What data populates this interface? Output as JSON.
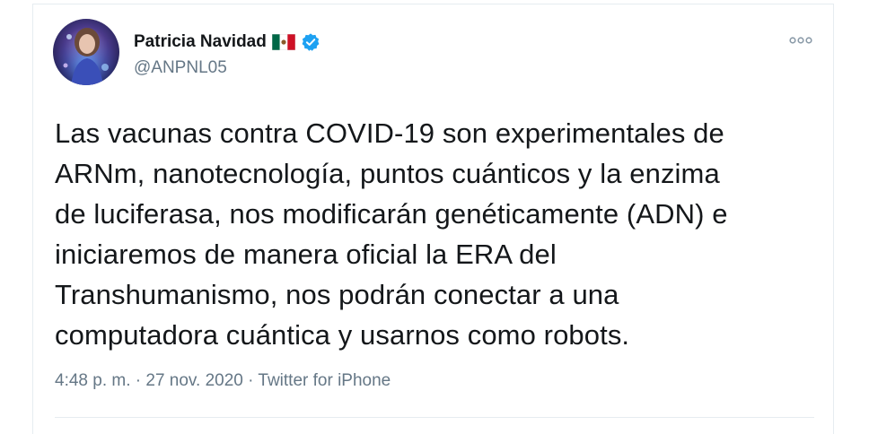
{
  "tweet": {
    "author": {
      "name": "Patricia Navidad",
      "handle": "@ANPNL05",
      "flag_icon": "mexico-flag-icon",
      "verified_icon": "verified-badge-icon"
    },
    "more_icon": "more-options-icon",
    "text_lines": [
      "Las vacunas contra COVID-19 son experimentales de",
      "ARNm, nanotecnología, puntos cuánticos y la enzima",
      "de luciferasa, nos modificarán genéticamente (ADN) e",
      "iniciaremos de manera oficial la ERA del",
      "Transhumanismo, nos podrán conectar a una",
      "computadora cuántica y usarnos como robots."
    ],
    "time": "4:48 p. m.",
    "separator": "·",
    "date": "27 nov. 2020",
    "source": "Twitter for iPhone"
  },
  "colors": {
    "text_primary": "#14171a",
    "text_secondary": "#657786",
    "verified_blue": "#1da1f2",
    "border": "#e6ecf0"
  }
}
